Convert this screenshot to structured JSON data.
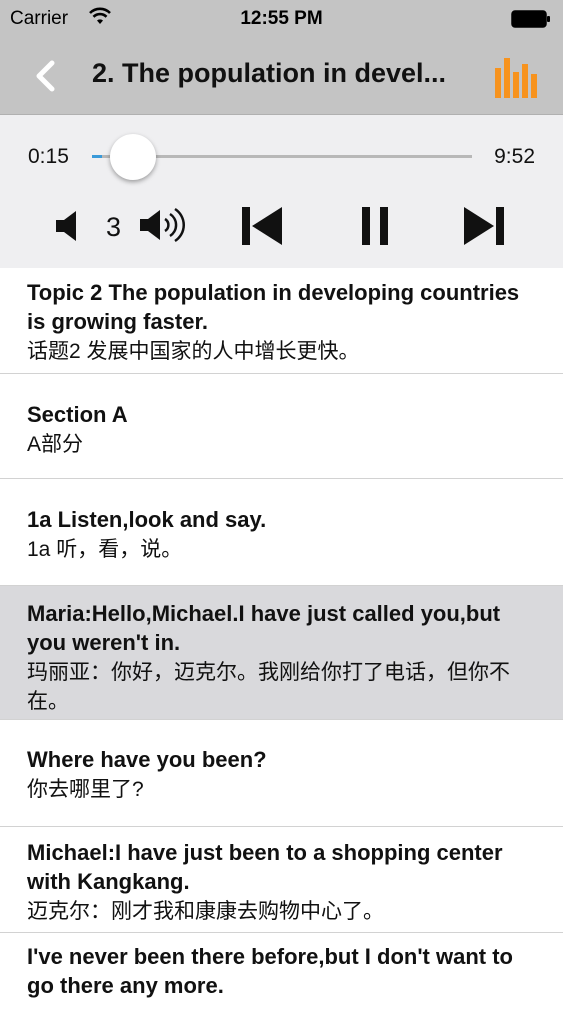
{
  "status_bar": {
    "carrier": "Carrier",
    "time": "12:55 PM"
  },
  "nav": {
    "title": "2. The population in devel...",
    "back_icon": "chevron-left-icon",
    "menu_icon": "equalizer-bars-icon",
    "accent_color": "#f7931e"
  },
  "player": {
    "current_time": "0:15",
    "duration": "9:52",
    "progress": 0.025,
    "volume_level": "3",
    "accent_color": "#3a9ad9"
  },
  "lines": [
    {
      "en": "Topic 2 The population in developing countries is growing faster.",
      "zh": "话题2 发展中国家的人中增长更快。",
      "highlighted": false
    },
    {
      "en": "Section A",
      "zh": "A部分",
      "highlighted": false
    },
    {
      "en": "1a Listen,look and say.",
      "zh": "1a 听，看，说。",
      "highlighted": false
    },
    {
      "en": "Maria:Hello,Michael.I have just called you,but you weren't in.",
      "zh": "玛丽亚：你好，迈克尔。我刚给你打了电话，但你不在。",
      "highlighted": true
    },
    {
      "en": "Where have you been?",
      "zh": "你去哪里了?",
      "highlighted": false
    },
    {
      "en": "Michael:I have just been to a shopping center with Kangkang.",
      "zh": "迈克尔：刚才我和康康去购物中心了。",
      "highlighted": false
    },
    {
      "en": "I've never been there before,but I don't want to go there any more.",
      "zh": "",
      "highlighted": false
    }
  ]
}
